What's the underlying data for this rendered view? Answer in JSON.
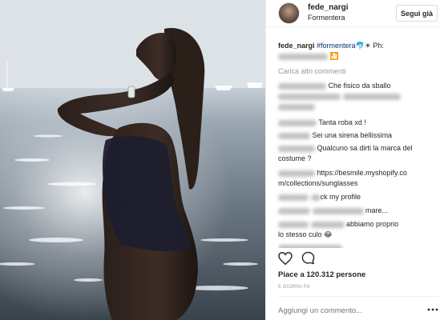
{
  "post": {
    "username": "fede_nargi",
    "location": "Formentera",
    "follow_label": "Segui già",
    "caption_user": "fede_nargi",
    "caption_tag": "#formentera",
    "caption_tail": "🐬☀ Ph:",
    "caption_end": "🎦",
    "load_more": "Carica altri commenti",
    "likes": "Piace a 120.312 persone",
    "time_ago": "5 GIORNI FA",
    "add_comment_placeholder": "Aggiungi un commento..."
  },
  "comments": [
    {
      "text": "Che fisico da sballo"
    },
    {
      "text": ""
    },
    {
      "text": "Tanta roba xd !"
    },
    {
      "text": "Sei una sirena bellissima"
    },
    {
      "text": "Qualcuno sa dirti la marca del"
    },
    {
      "text": "costume ?"
    },
    {
      "text": "https://besmile.myshopify.co"
    },
    {
      "text": "m/collections/sunglasses"
    },
    {
      "text": "ck my profile"
    },
    {
      "text": "mare..."
    },
    {
      "text": "abbiamo proprio"
    },
    {
      "text": "lo stesso culo 😂"
    }
  ],
  "icons": [
    "heart-icon",
    "comment-icon",
    "more-options-icon"
  ]
}
